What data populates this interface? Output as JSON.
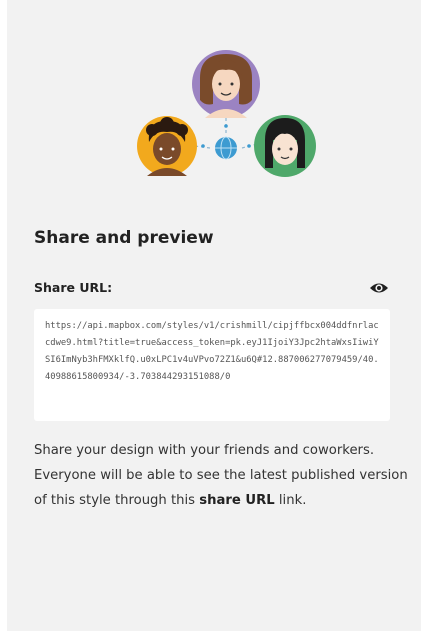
{
  "panel": {
    "title": "Share and preview",
    "share_url_label": "Share URL:",
    "share_url": "https://api.mapbox.com/styles/v1/crishmill/cipjffbcx004ddfnrlaccdwe9.html?title=true&access_token=pk.eyJ1IjoiY3Jpc2htaWxsIiwiYSI6ImNyb3hFMXklfQ.u0xLPC1v4uVPvo72Z1&u6Q#12.887006277079459/40.40988615800934/-3.703844293151088/0",
    "description": {
      "part1": "Share your design with your friends and coworkers. Everyone will be able to see the latest published version of this style through this ",
      "bold1": "share URL",
      "part2": " link."
    },
    "icons": {
      "preview": "eye-icon",
      "connector": "globe-icon"
    }
  },
  "colors": {
    "panel_bg": "#f2f2f2",
    "url_bg": "#ffffff",
    "avatar_purple": "#9b83c2",
    "avatar_orange": "#f2a91d",
    "avatar_green": "#4fa86a",
    "connector_blue": "#3d9bd1"
  }
}
